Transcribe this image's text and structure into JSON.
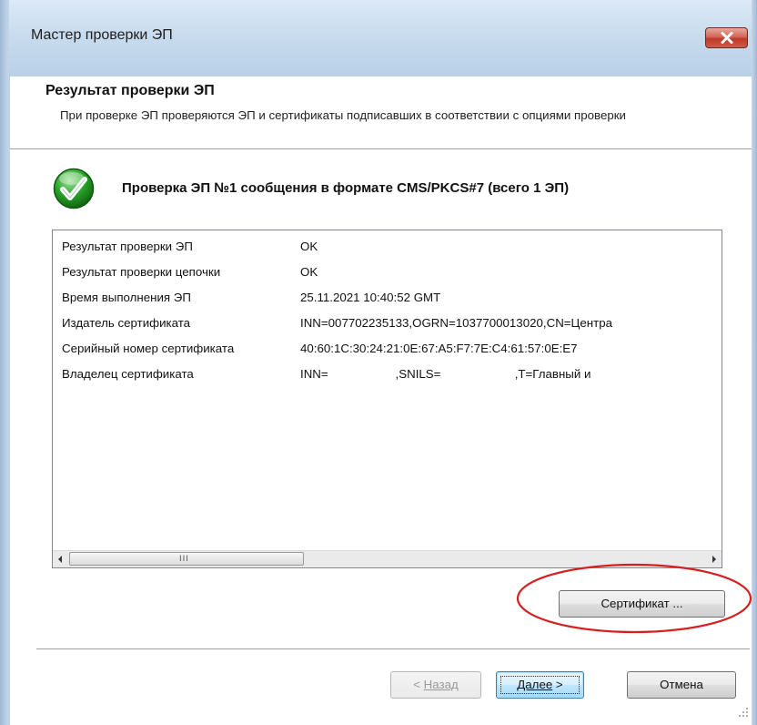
{
  "window": {
    "title": "Мастер проверки ЭП",
    "close_glyph": "✕"
  },
  "header": {
    "title": "Результат проверки ЭП",
    "description": "При проверке ЭП проверяются ЭП и сертификаты подписавших в соответствии с опциями проверки"
  },
  "result": {
    "icon": "green-check-icon",
    "caption": "Проверка ЭП №1 сообщения в формате CMS/PKCS#7 (всего 1 ЭП)"
  },
  "details": {
    "rows": [
      {
        "label": "Результат проверки ЭП",
        "value": "OK"
      },
      {
        "label": "Результат проверки цепочки",
        "value": "OK"
      },
      {
        "label": "Время выполнения ЭП",
        "value": "25.11.2021  10:40:52 GMT"
      },
      {
        "label": "Издатель сертификата",
        "value": "INN=007702235133,OGRN=1037700013020,CN=Центра"
      },
      {
        "label": "Серийный номер сертификата",
        "value": "40:60:1C:30:24:21:0E:67:A5:F7:7E:C4:61:57:0E:E7"
      },
      {
        "label": "Владелец сертификата",
        "value": "INN=                    ,SNILS=                      ,T=Главный и"
      }
    ],
    "scrollbar": {
      "left_arrow": "◀",
      "right_arrow": "▶",
      "thumb_grip": "III"
    }
  },
  "buttons": {
    "certificate": "Сертификат ...",
    "back_prefix": "< ",
    "back_label": "Назад",
    "next_label": "Далее",
    "next_suffix": " >",
    "cancel": "Отмена"
  },
  "colors": {
    "title_bar": "#c9dcee",
    "close_button": "#c0392b",
    "annotation_ellipse": "#d62020",
    "check_green": "#2aa32a"
  }
}
